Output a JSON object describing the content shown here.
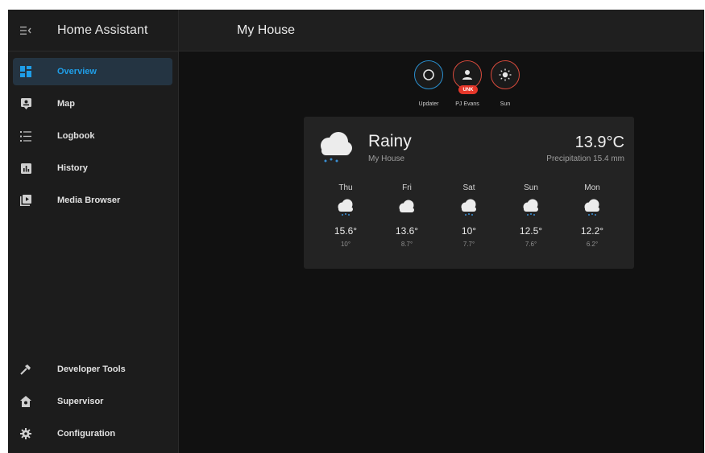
{
  "app": {
    "title": "Home Assistant"
  },
  "page": {
    "title": "My House"
  },
  "sidebar": {
    "items": [
      {
        "label": "Overview",
        "icon": "view-dashboard-icon",
        "active": true
      },
      {
        "label": "Map",
        "icon": "map-icon"
      },
      {
        "label": "Logbook",
        "icon": "logbook-icon"
      },
      {
        "label": "History",
        "icon": "chart-history-icon"
      },
      {
        "label": "Media Browser",
        "icon": "media-browser-icon"
      },
      {
        "label": "Developer Tools",
        "icon": "hammer-icon"
      },
      {
        "label": "Supervisor",
        "icon": "supervisor-icon"
      },
      {
        "label": "Configuration",
        "icon": "cog-icon"
      }
    ]
  },
  "badges": [
    {
      "label": "Updater",
      "icon": "circle-outline-icon",
      "color": "#2a8fcf"
    },
    {
      "label": "PJ Evans",
      "icon": "account-icon",
      "color": "#d84a3c",
      "state": "UNK"
    },
    {
      "label": "Sun",
      "icon": "sun-icon",
      "color": "#d84a3c"
    }
  ],
  "weather": {
    "state": "Rainy",
    "name": "My House",
    "temperature": "13.9°C",
    "precipitation": "Precipitation 15.4 mm",
    "forecast": [
      {
        "day": "Thu",
        "high": "15.6°",
        "low": "10°"
      },
      {
        "day": "Fri",
        "high": "13.6°",
        "low": "8.7°"
      },
      {
        "day": "Sat",
        "high": "10°",
        "low": "7.7°"
      },
      {
        "day": "Sun",
        "high": "12.5°",
        "low": "7.6°"
      },
      {
        "day": "Mon",
        "high": "12.2°",
        "low": "6.2°"
      }
    ]
  },
  "colors": {
    "accent": "#1f9ee8",
    "background": "#111111",
    "sidebar": "#1c1c1c"
  }
}
